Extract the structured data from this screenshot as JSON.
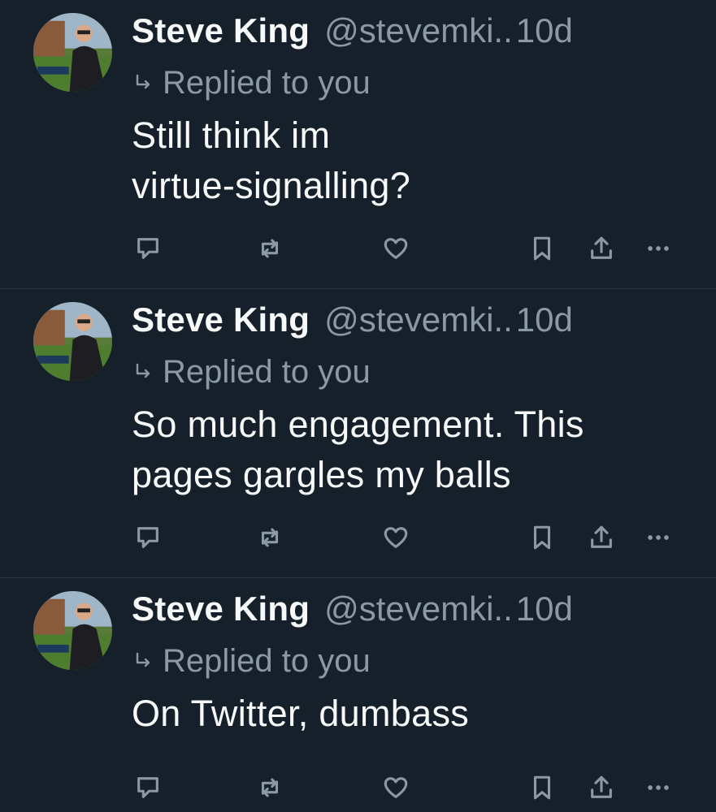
{
  "tweets": [
    {
      "name": "Steve King",
      "handle": "@stevemki..",
      "time": "10d",
      "replied": "Replied to you",
      "text": "Still think im\nvirtue-signalling?"
    },
    {
      "name": "Steve King",
      "handle": "@stevemki..",
      "time": "10d",
      "replied": "Replied to you",
      "text": "So much engagement. This\npages gargles my balls"
    },
    {
      "name": "Steve King",
      "handle": "@stevemki..",
      "time": "10d",
      "replied": "Replied to you",
      "text": "On Twitter, dumbass"
    }
  ],
  "icons": {
    "reply": "reply-icon",
    "retweet": "retweet-icon",
    "like": "heart-icon",
    "bookmark": "bookmark-icon",
    "share": "share-icon",
    "more": "more-icon"
  },
  "colors": {
    "background": "#15202b",
    "text": "#f7f9f9",
    "muted": "#8b98a5",
    "divider": "#2a3642"
  }
}
